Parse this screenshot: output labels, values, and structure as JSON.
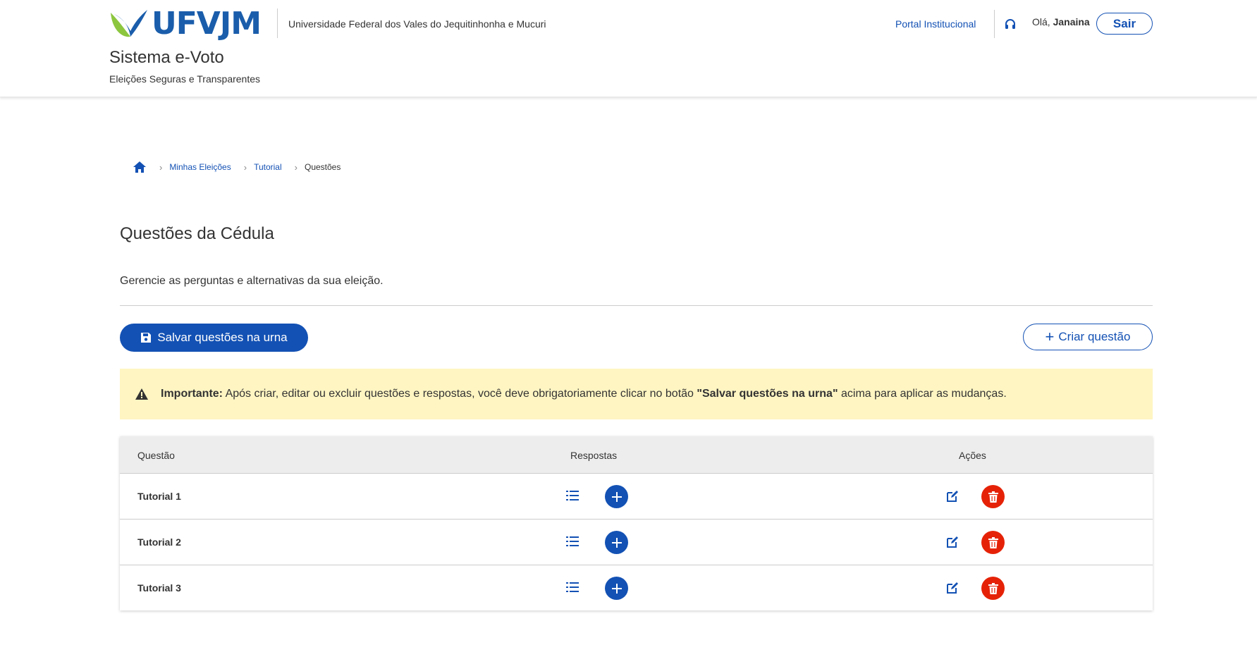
{
  "header": {
    "logo_text": "UFVJM",
    "university": "Universidade Federal dos Vales do Jequitinhonha e Mucuri",
    "system_title": "Sistema e-Voto",
    "system_subtitle": "Eleições Seguras e Transparentes",
    "portal_link": "Portal Institucional",
    "greeting_prefix": "Olá,",
    "user_name": "Janaina",
    "logout_label": "Sair",
    "help_icon": "headset-icon"
  },
  "breadcrumb": {
    "home_icon": "home-icon",
    "items": [
      "Minhas Eleições",
      "Tutorial",
      "Questões"
    ]
  },
  "page": {
    "title": "Questões da Cédula",
    "description": "Gerencie as perguntas e alternativas da sua eleição."
  },
  "actions": {
    "save_label": "Salvar questões na urna",
    "save_icon": "floppy-disk-icon",
    "create_label": "Criar questão"
  },
  "alert": {
    "strong": "Importante:",
    "text_before": "Após criar, editar ou excluir questões e respostas, você deve obrigatoriamente clicar no botão",
    "quoted": "\"Salvar questões na urna\"",
    "text_after": "acima para aplicar as mudanças."
  },
  "table": {
    "headers": [
      "Questão",
      "Respostas",
      "Ações"
    ],
    "rows": [
      {
        "question": "Tutorial 1"
      },
      {
        "question": "Tutorial 2"
      },
      {
        "question": "Tutorial 3"
      }
    ]
  },
  "colors": {
    "primary": "#1351b4",
    "danger": "#e52207",
    "alert_bg": "#fff5c2",
    "logo_blue": "#1a5dab",
    "logo_green": "#8cc63f"
  }
}
